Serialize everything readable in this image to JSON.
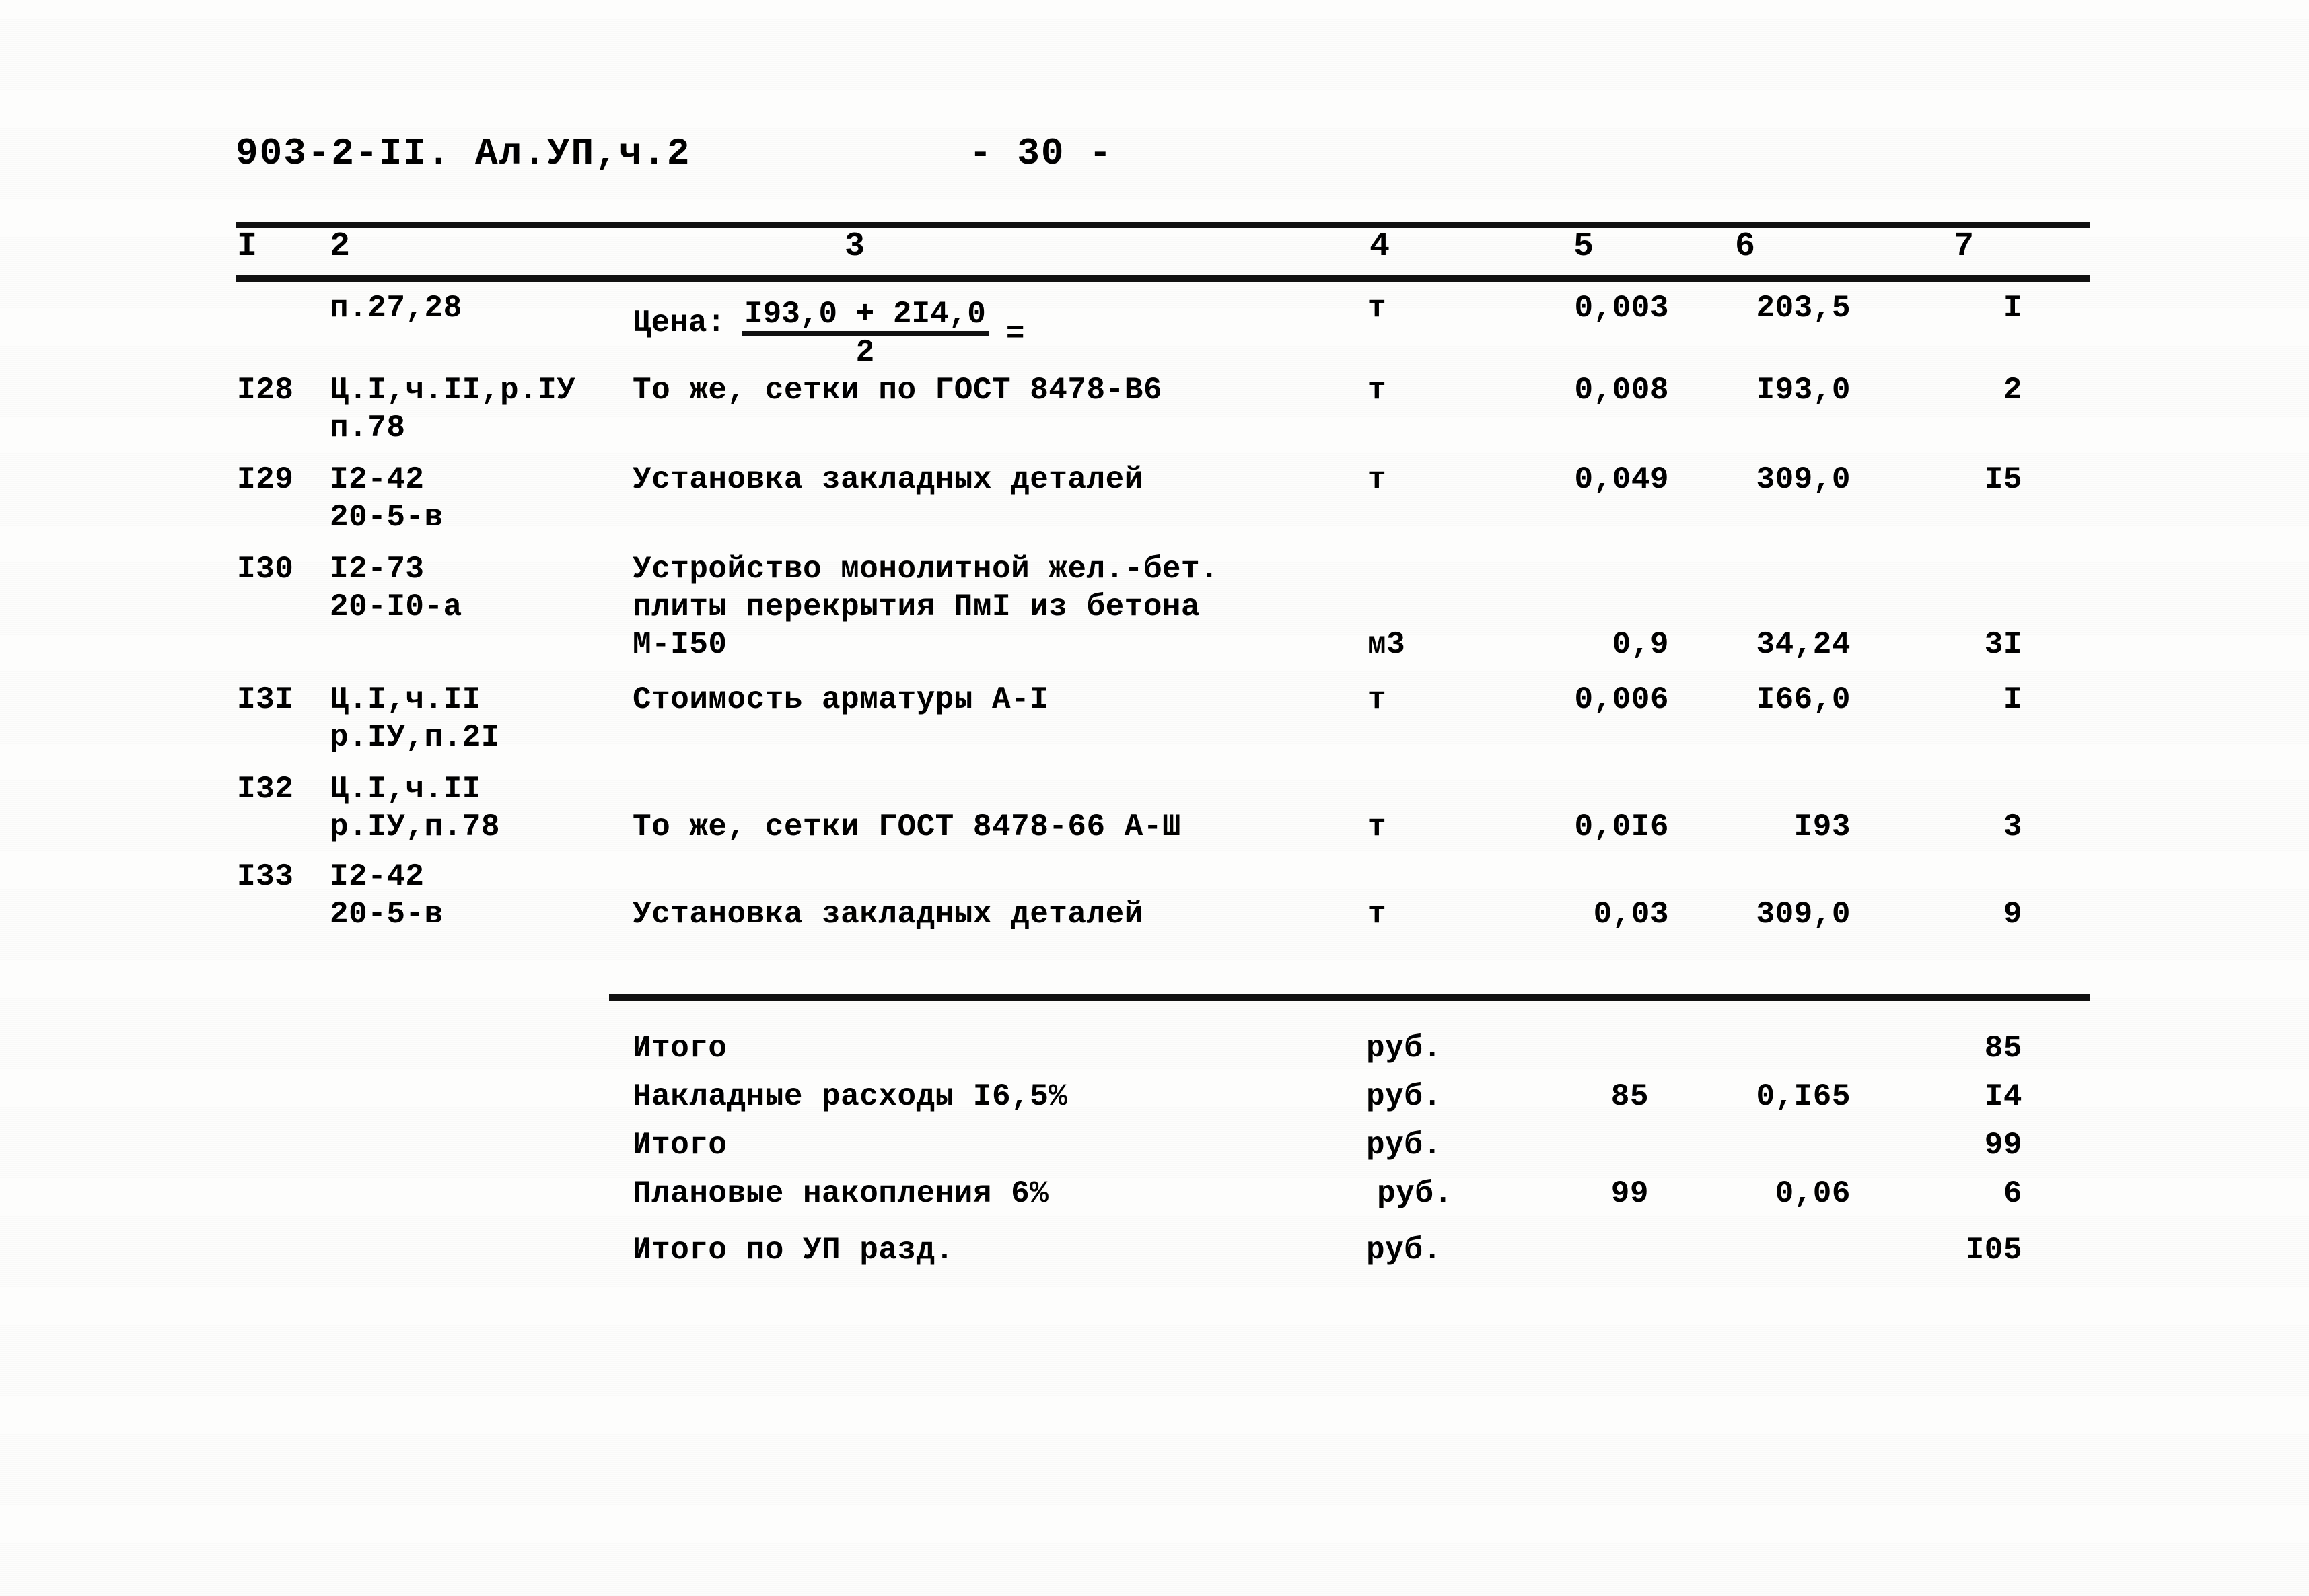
{
  "header": {
    "doc_code": "903-2-II.  Ал.УП,ч.2",
    "page_number": "- 30 -"
  },
  "table": {
    "column_headers": [
      "I",
      "2",
      "3",
      "4",
      "5",
      "6",
      "7"
    ],
    "rows": [
      {
        "num": "",
        "justification": "п.27,28",
        "description_formula": {
          "lead": "Цена:",
          "numerator": "I93,0 + 2I4,0",
          "denominator": "2",
          "equals": "="
        },
        "unit": "т",
        "qty": "0,003",
        "price": "203,5",
        "total": "I"
      },
      {
        "num": "I28",
        "justification": "Ц.I,ч.II,р.IУ\nп.78",
        "description": "То же, сетки по ГОСТ 8478-В6",
        "unit": "т",
        "qty": "0,008",
        "price": "I93,0",
        "total": "2"
      },
      {
        "num": "I29",
        "justification": "I2-42\n20-5-в",
        "description": "Установка закладных деталей",
        "unit": "т",
        "qty": "0,049",
        "price": "309,0",
        "total": "I5"
      },
      {
        "num": "I30",
        "justification": "I2-73\n20-I0-а",
        "description": "Устройство монолитной жел.-бет.\nплиты перекрытия ПмI из бетона\nМ-I50",
        "unit": "м3",
        "qty": "0,9",
        "price": "34,24",
        "total": "3I"
      },
      {
        "num": "I3I",
        "justification": "Ц.I,ч.II\nр.IУ,п.2I",
        "description": "Стоимость арматуры А-I",
        "unit": "т",
        "qty": "0,006",
        "price": "I66,0",
        "total": "I"
      },
      {
        "num": "I32",
        "justification": "Ц.I,ч.II\nр.IУ,п.78",
        "description": "То же, сетки ГОСТ 8478-66 А-Ш",
        "unit": "т",
        "qty": "0,0I6",
        "price": "I93",
        "total": "3"
      },
      {
        "num": "I33",
        "justification": "I2-42\n20-5-в",
        "description": "Установка закладных деталей",
        "unit": "т",
        "qty": "0,03",
        "price": "309,0",
        "total": "9"
      }
    ]
  },
  "summary": {
    "rows": [
      {
        "label": "Итого",
        "unit": "руб.",
        "base": "",
        "coef": "",
        "value": "85"
      },
      {
        "label": "Накладные расходы I6,5%",
        "unit": "руб.",
        "base": "85",
        "coef": "0,I65",
        "value": "I4"
      },
      {
        "label": "Итого",
        "unit": "руб.",
        "base": "",
        "coef": "",
        "value": "99"
      },
      {
        "label": "Плановые накопления 6%",
        "unit": "руб.",
        "base": "99",
        "coef": "0,06",
        "value": "6"
      },
      {
        "label": "Итого по УП разд.",
        "unit": "руб.",
        "base": "",
        "coef": "",
        "value": "I05"
      }
    ]
  }
}
